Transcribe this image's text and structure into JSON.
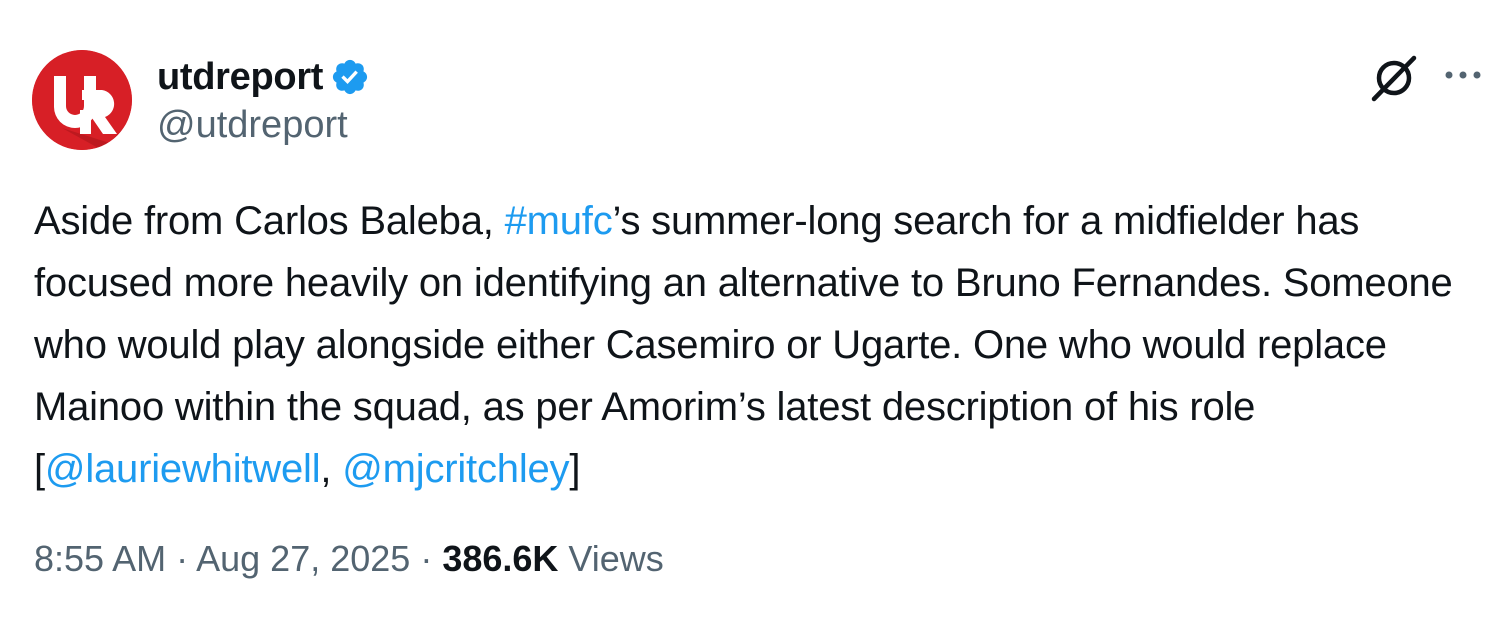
{
  "author": {
    "display_name": "utdreport",
    "handle": "@utdreport",
    "verified": true,
    "avatar_icon": "ur-logo-icon",
    "avatar_color": "#d71f26"
  },
  "tweet": {
    "text_parts": {
      "p1": "Aside from Carlos Baleba, ",
      "hashtag": "#mufc",
      "p2": "’s summer-long search for a midfielder has focused more heavily on identifying an alternative to Bruno Fernandes. Someone who would play alongside either Casemiro or Ugarte. One who would replace Mainoo within the squad, as per Amorim’s latest description of his role [",
      "mention1": "@lauriewhitwell",
      "sep": ", ",
      "mention2": "@mjcritchley",
      "p3": "]"
    },
    "time": "8:55 AM",
    "dot1": " · ",
    "date": "Aug 27, 2025",
    "dot2": " · ",
    "views_count": "386.6K",
    "views_label": " Views"
  },
  "colors": {
    "link": "#1d9bf0",
    "secondary_text": "#536471",
    "primary_text": "#0f1419",
    "verified_badge": "#1d9bf0"
  },
  "icons": {
    "grok": "grok-icon",
    "more": "more-options-icon",
    "verified": "verified-badge-icon"
  }
}
